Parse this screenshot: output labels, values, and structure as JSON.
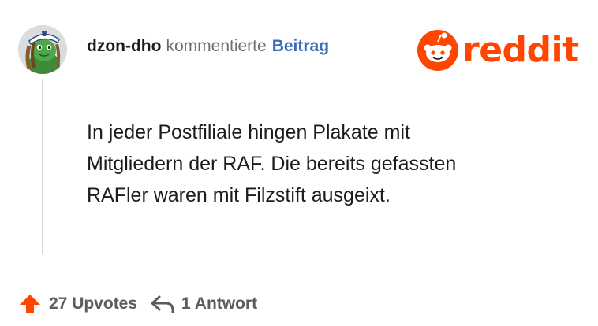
{
  "comment": {
    "author": "dzon-dho",
    "action": "kommentierte",
    "target_link": "Beitrag",
    "body_lines": [
      "In jeder Postfiliale hingen Plakate mit",
      "Mitgliedern der RAF. Die bereits gefassten",
      "RAFler waren mit Filzstift ausgeixt."
    ]
  },
  "brand": {
    "name": "reddit",
    "color": "#ff4500",
    "icon": "snoo-icon"
  },
  "footer": {
    "upvotes_label": "27 Upvotes",
    "replies_label": "1 Antwort",
    "upvote_icon": "arrow-up-icon",
    "reply_icon": "reply-arrow-icon"
  },
  "colors": {
    "author": "#1c1c1c",
    "meta": "#6b6e70",
    "link": "#3a6fb5",
    "upvote": "#ff4500",
    "footer_text": "#5a5d60"
  }
}
